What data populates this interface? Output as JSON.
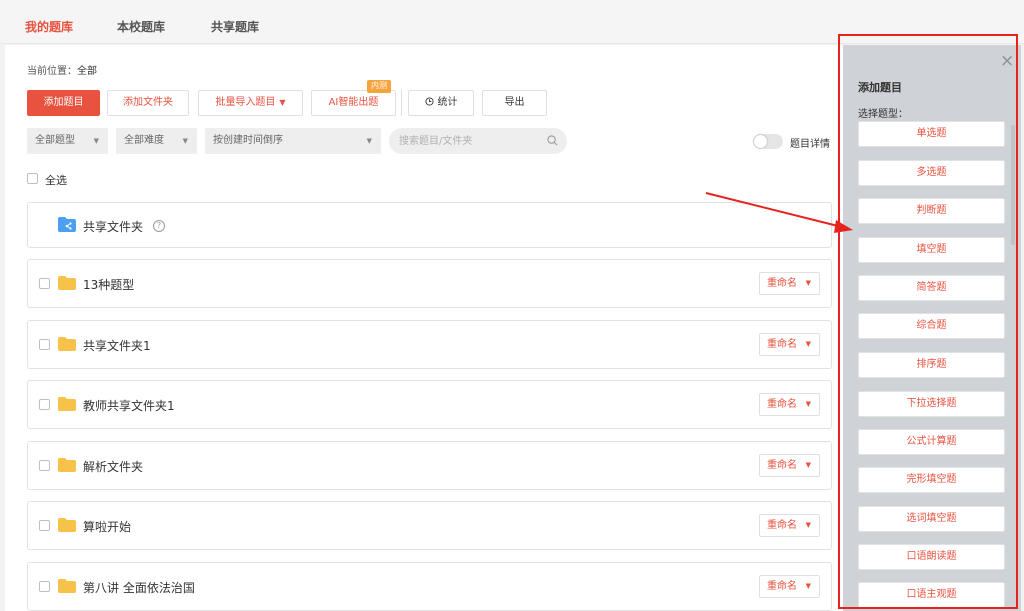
{
  "nav": {
    "tabs": [
      {
        "label": "我的题库",
        "active": true
      },
      {
        "label": "本校题库",
        "active": false
      },
      {
        "label": "共享题库",
        "active": false
      }
    ]
  },
  "breadcrumb": {
    "prefix": "当前位置：",
    "current": "全部"
  },
  "toolbar": {
    "add_question": "添加题目",
    "add_folder": "添加文件夹",
    "batch_import": "批量导入题目",
    "ai_generate": "AI智能出题",
    "ai_badge": "内测",
    "stats": "统计",
    "export": "导出"
  },
  "filters": {
    "type": "全部题型",
    "difficulty": "全部难度",
    "sort": "按创建时间倒序",
    "search_placeholder": "搜索题目/文件夹",
    "detail_toggle_label": "题目详情",
    "detail_toggle_on": false
  },
  "select_all": "全选",
  "shared_folder": {
    "label": "共享文件夹",
    "help": "?"
  },
  "folders": [
    {
      "name": "13种题型",
      "action": "重命名"
    },
    {
      "name": "共享文件夹1",
      "action": "重命名"
    },
    {
      "name": "教师共享文件夹1",
      "action": "重命名"
    },
    {
      "name": "解析文件夹",
      "action": "重命名"
    },
    {
      "name": "算啦开始",
      "action": "重命名"
    },
    {
      "name": "第八讲 全面依法治国",
      "action": "重命名"
    }
  ],
  "panel": {
    "title": "添加题目",
    "subtitle": "选择题型：",
    "close": "×",
    "types": [
      "单选题",
      "多选题",
      "判断题",
      "填空题",
      "简答题",
      "综合题",
      "排序题",
      "下拉选择题",
      "公式计算题",
      "完形填空题",
      "选词填空题",
      "口语朗读题",
      "口语主观题"
    ]
  },
  "colors": {
    "accent": "#e8523f",
    "annotation": "#e8231d",
    "badge": "#f5a33b",
    "folder_yellow": "#f7c24a",
    "folder_blue": "#4d9ff2"
  }
}
